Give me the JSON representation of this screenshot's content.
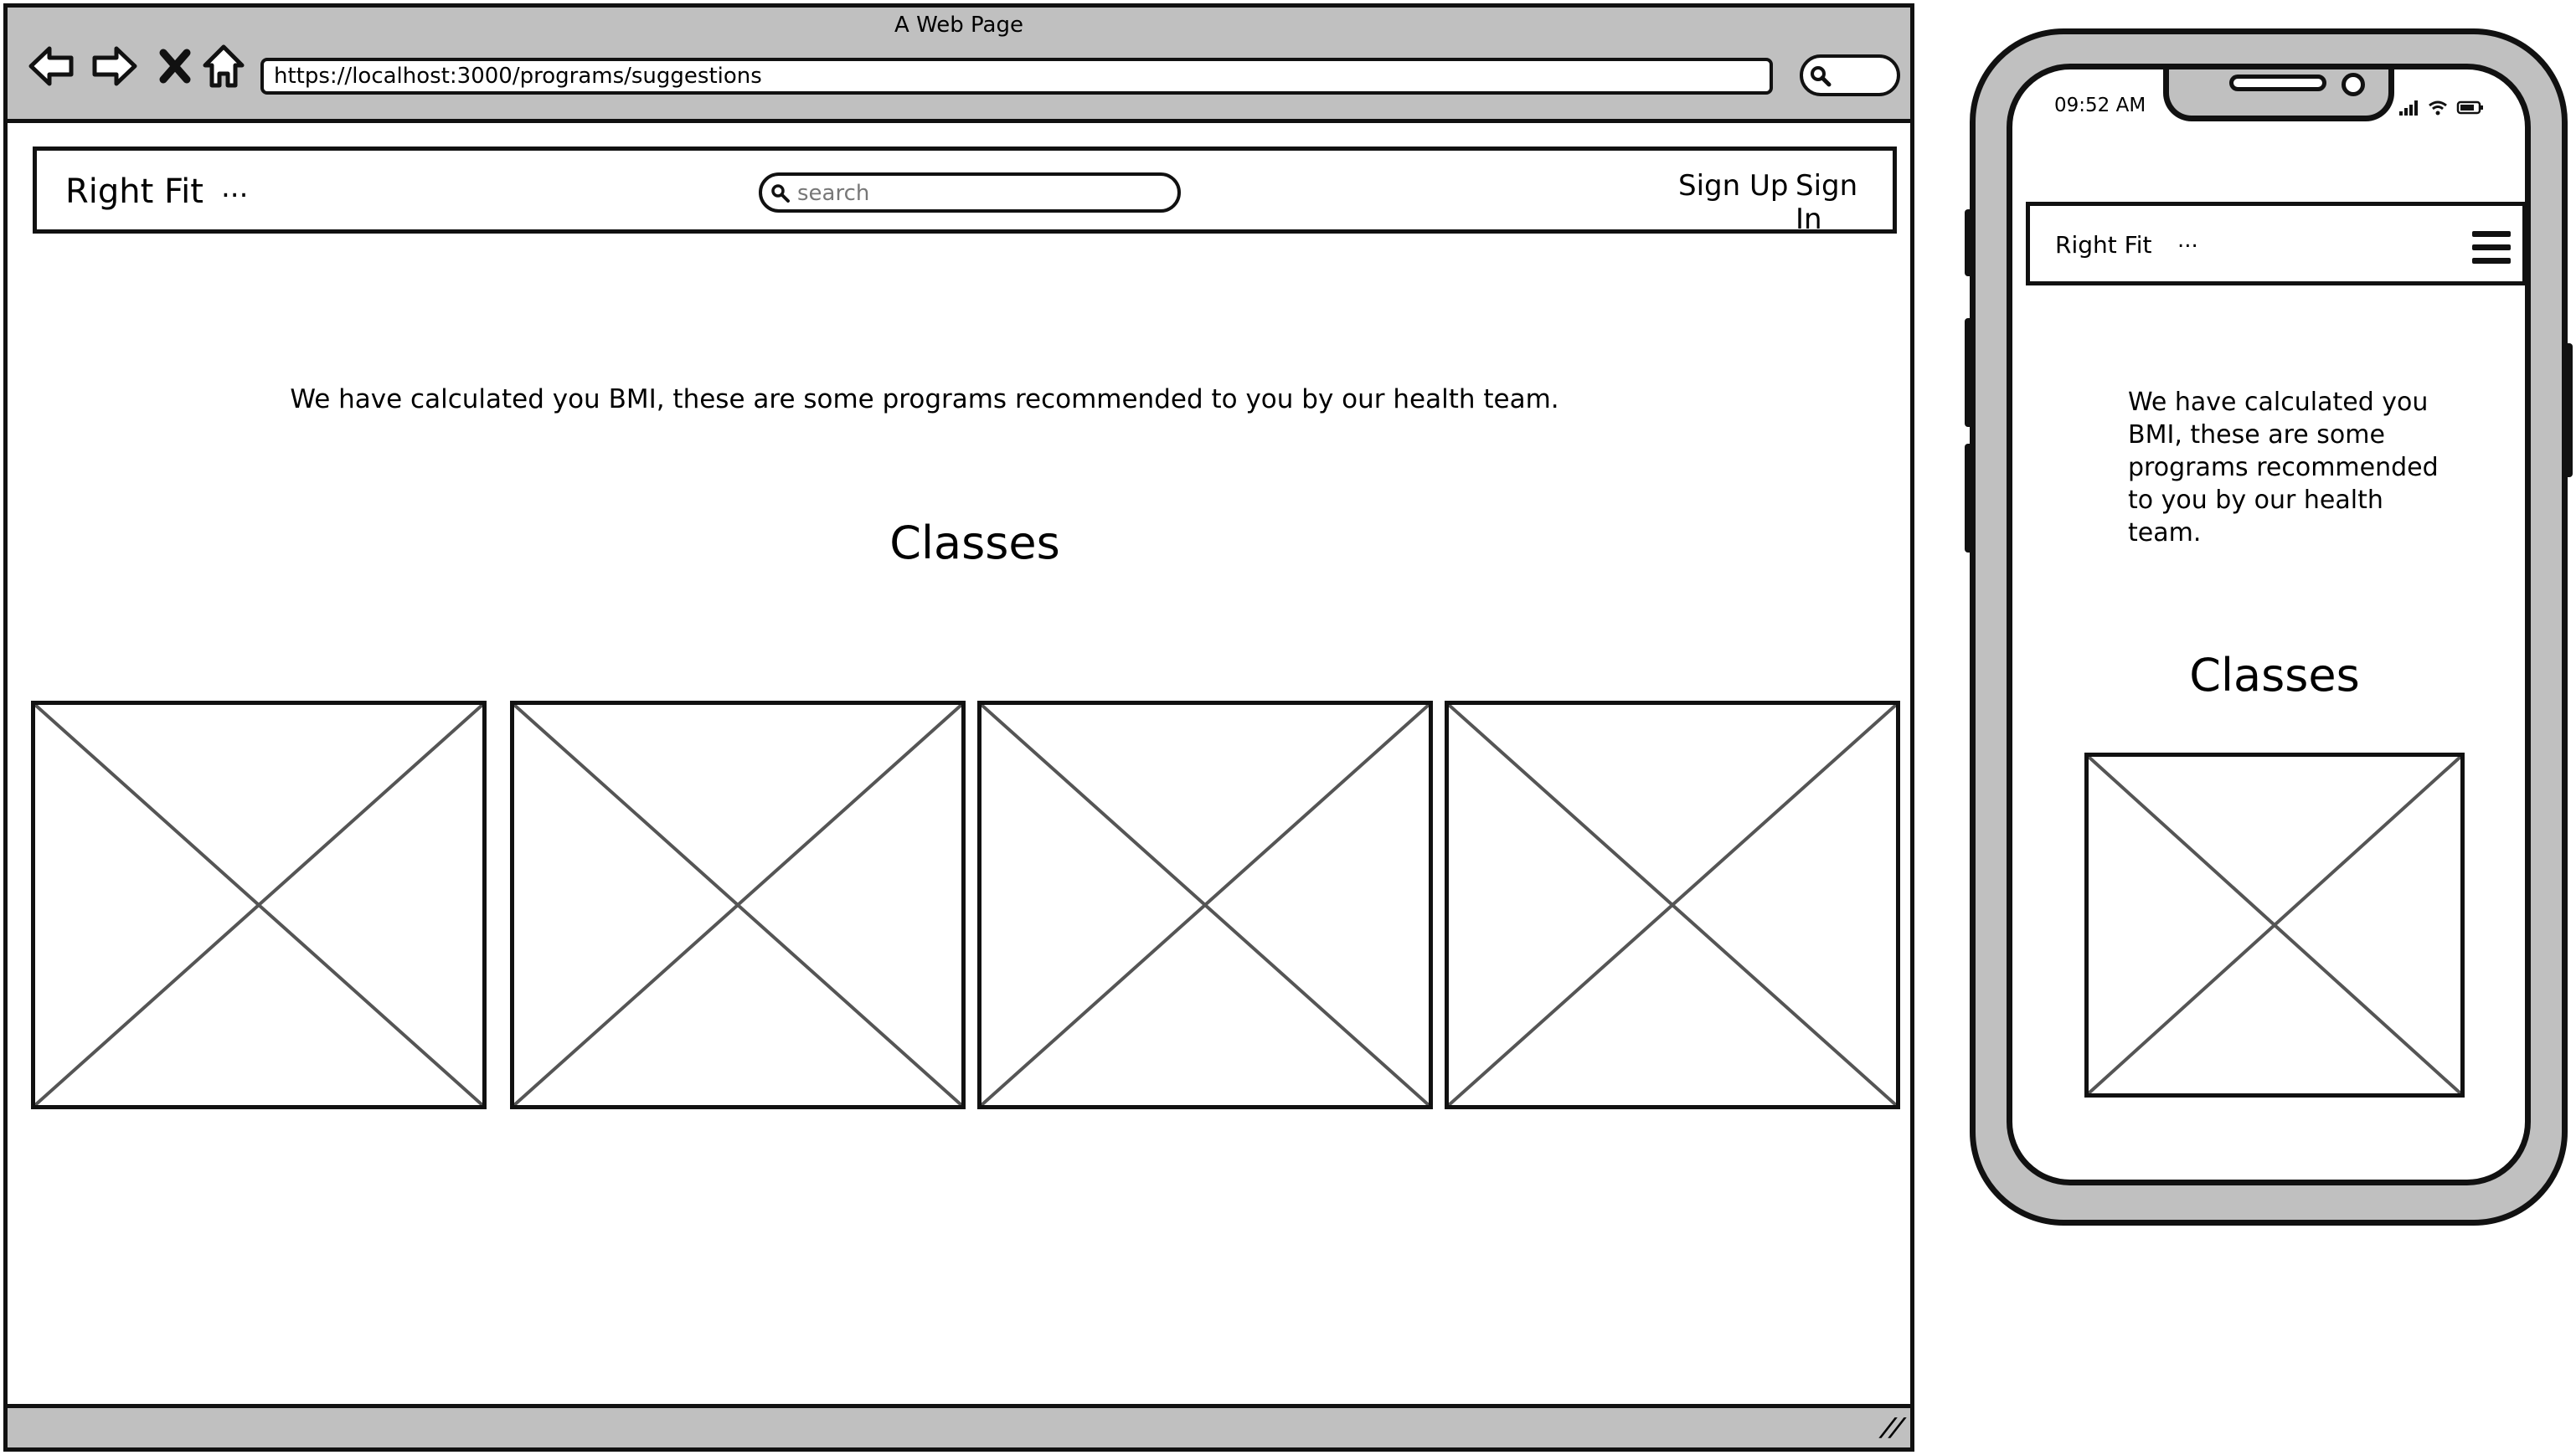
{
  "browser": {
    "window_title": "A Web Page",
    "url": "https://localhost:3000/programs/suggestions",
    "nav_icons": [
      "back-arrow-icon",
      "forward-arrow-icon",
      "close-x-icon",
      "home-icon"
    ]
  },
  "site": {
    "brand": "Right Fit",
    "brand_suffix": "...",
    "search_placeholder": "search",
    "signup_label": "Sign Up",
    "signin_label": "Sign In"
  },
  "content": {
    "message": "We have calculated you BMI, these are some programs recommended to you by our health team.",
    "section_title": "Classes",
    "class_placeholders_desktop": 4,
    "class_placeholders_mobile": 1
  },
  "mobile": {
    "time": "09:52 AM",
    "menu_icon": "hamburger-menu-icon"
  },
  "colors": {
    "chrome_gray": "#c0c0c0",
    "outline": "#111111",
    "placeholder_cross": "#555555"
  }
}
